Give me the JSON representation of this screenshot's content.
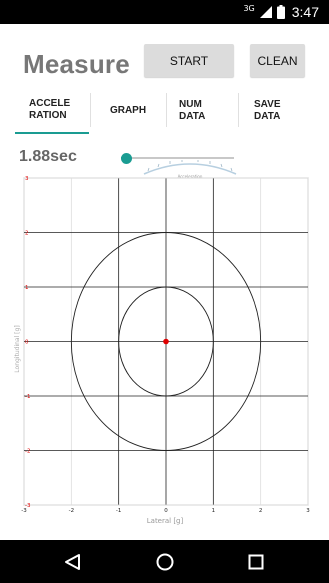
{
  "status_bar": {
    "network": "3G",
    "time": "3:47"
  },
  "app": {
    "title": "Measure"
  },
  "toolbar": {
    "start_label": "START",
    "clean_label": "CLEAN"
  },
  "tabs": [
    {
      "lines": [
        "ACCELE",
        "RATION"
      ],
      "selected": true
    },
    {
      "lines": [
        "GRAPH"
      ],
      "selected": false
    },
    {
      "lines": [
        "NUM",
        "DATA"
      ],
      "selected": false
    },
    {
      "lines": [
        "SAVE",
        "DATA"
      ],
      "selected": false
    }
  ],
  "playback": {
    "time": "1.88sec",
    "slider_fraction": 0.04
  },
  "gauge": {
    "caption": "Acceleration"
  },
  "chart_data": {
    "type": "scatter",
    "xlabel": "Lateral [g]",
    "ylabel": "Longitudinal [g]",
    "xlim": [
      -3,
      3
    ],
    "ylim": [
      -3,
      3
    ],
    "x_ticks": [
      "-3",
      "-2",
      "-1",
      "0",
      "1",
      "2",
      "3"
    ],
    "y_ticks": [
      "3",
      "2",
      "1",
      "0",
      "-1",
      "-2",
      "-3"
    ],
    "grid": true,
    "reference_rings": [
      {
        "name": "inner",
        "rx": 1,
        "ry": 1
      },
      {
        "name": "outer",
        "rx": 2,
        "ry": 2
      }
    ],
    "points": [
      {
        "x": 0,
        "y": 0
      }
    ],
    "colors": {
      "point": "#e00000",
      "tick_y": "#e00000",
      "tick_x": "#222222",
      "grid": "#dddddd",
      "axis": "#222222"
    }
  },
  "accent_color": "#1a9c92"
}
